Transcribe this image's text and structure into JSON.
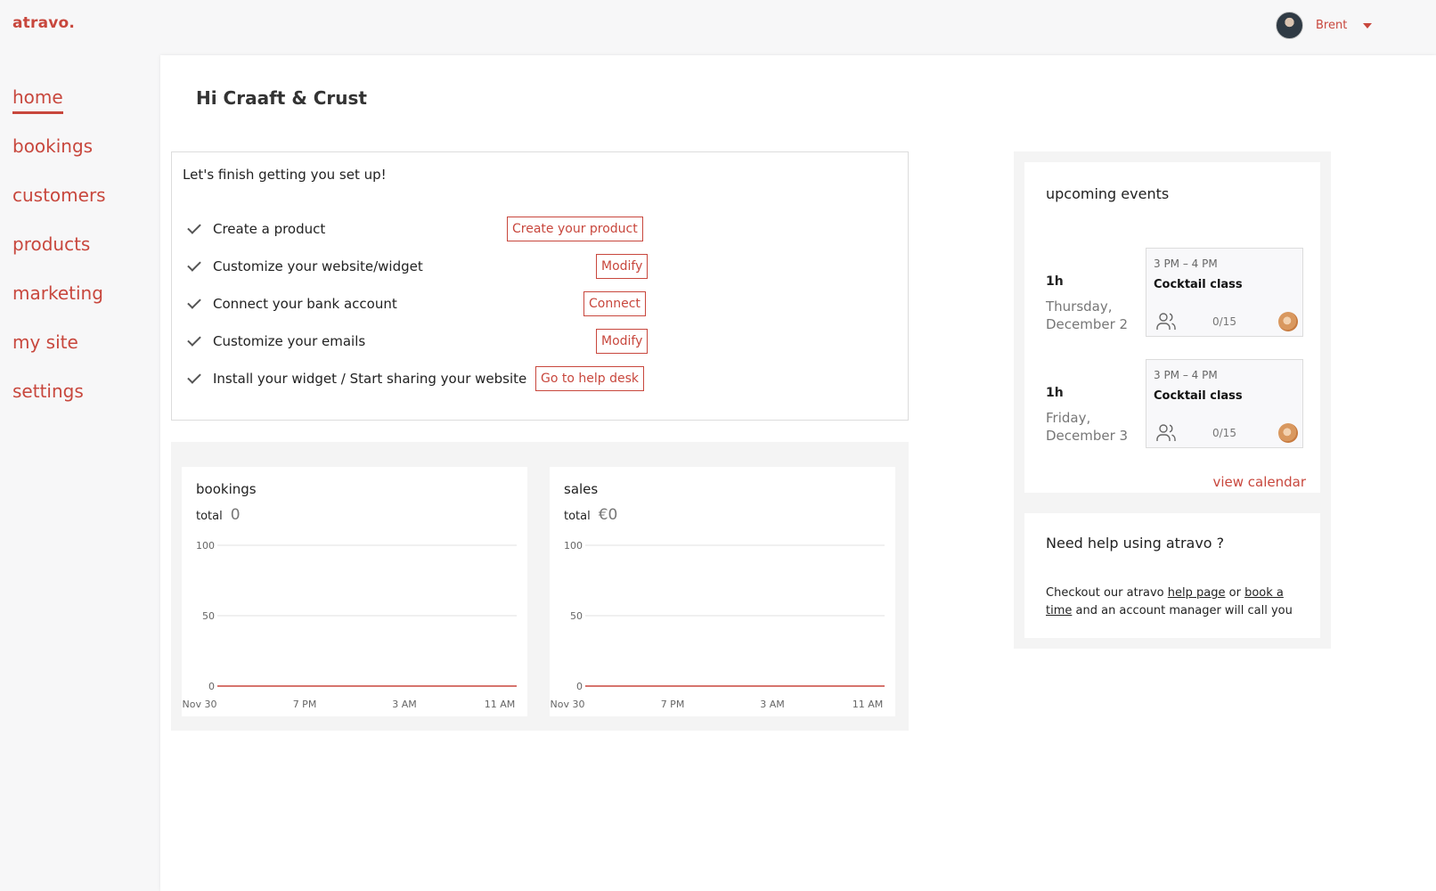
{
  "app": {
    "logo": "atravo."
  },
  "user": {
    "name": "Brent"
  },
  "sidebar": {
    "items": [
      {
        "label": "home",
        "active": true
      },
      {
        "label": "bookings"
      },
      {
        "label": "customers"
      },
      {
        "label": "products"
      },
      {
        "label": "marketing"
      },
      {
        "label": "my site"
      },
      {
        "label": "settings"
      }
    ]
  },
  "main": {
    "greeting": "Hi Craaft & Crust"
  },
  "setup": {
    "title": "Let's finish getting you set up!",
    "tasks": [
      {
        "label": "Create a product",
        "button": "Create your product"
      },
      {
        "label": "Customize your website/widget",
        "button": "Modify"
      },
      {
        "label": "Connect your bank account",
        "button": "Connect"
      },
      {
        "label": "Customize your emails",
        "button": "Modify"
      },
      {
        "label": "Install your widget / Start sharing your website",
        "button": "Go to help desk"
      }
    ]
  },
  "charts": {
    "bookings": {
      "title": "bookings",
      "total_label": "total",
      "total_value": "0"
    },
    "sales": {
      "title": "sales",
      "total_label": "total",
      "total_value": "€0"
    }
  },
  "chart_data": [
    {
      "type": "line",
      "title": "bookings",
      "x": [
        "Nov 30",
        "7 PM",
        "3 AM",
        "11 AM"
      ],
      "series": [
        {
          "values": [
            0,
            0,
            0,
            0
          ]
        }
      ],
      "yticks": [
        "100",
        "50",
        "0"
      ],
      "ylim": [
        0,
        100
      ],
      "color": "#c8473d",
      "grid": true
    },
    {
      "type": "line",
      "title": "sales",
      "x": [
        "Nov 30",
        "7 PM",
        "3 AM",
        "11 AM"
      ],
      "series": [
        {
          "values": [
            0,
            0,
            0,
            0
          ]
        }
      ],
      "yticks": [
        "100",
        "50",
        "0"
      ],
      "ylim": [
        0,
        100
      ],
      "color": "#c8473d",
      "grid": true
    }
  ],
  "events": {
    "title": "upcoming events",
    "items": [
      {
        "duration": "1h",
        "date": "Thursday, December 2",
        "time": "3 PM – 4 PM",
        "name": "Cocktail class",
        "count": "0/15"
      },
      {
        "duration": "1h",
        "date": "Friday, December 3",
        "time": "3 PM – 4 PM",
        "name": "Cocktail class",
        "count": "0/15"
      }
    ],
    "view_calendar": "view calendar"
  },
  "help": {
    "title": "Need help using atravo ?",
    "text_1": "Checkout our atravo ",
    "link_1": "help page",
    "text_2": " or ",
    "link_2": "book a time",
    "text_3": " and an account manager will call you"
  },
  "colors": {
    "accent": "#c8473d"
  }
}
